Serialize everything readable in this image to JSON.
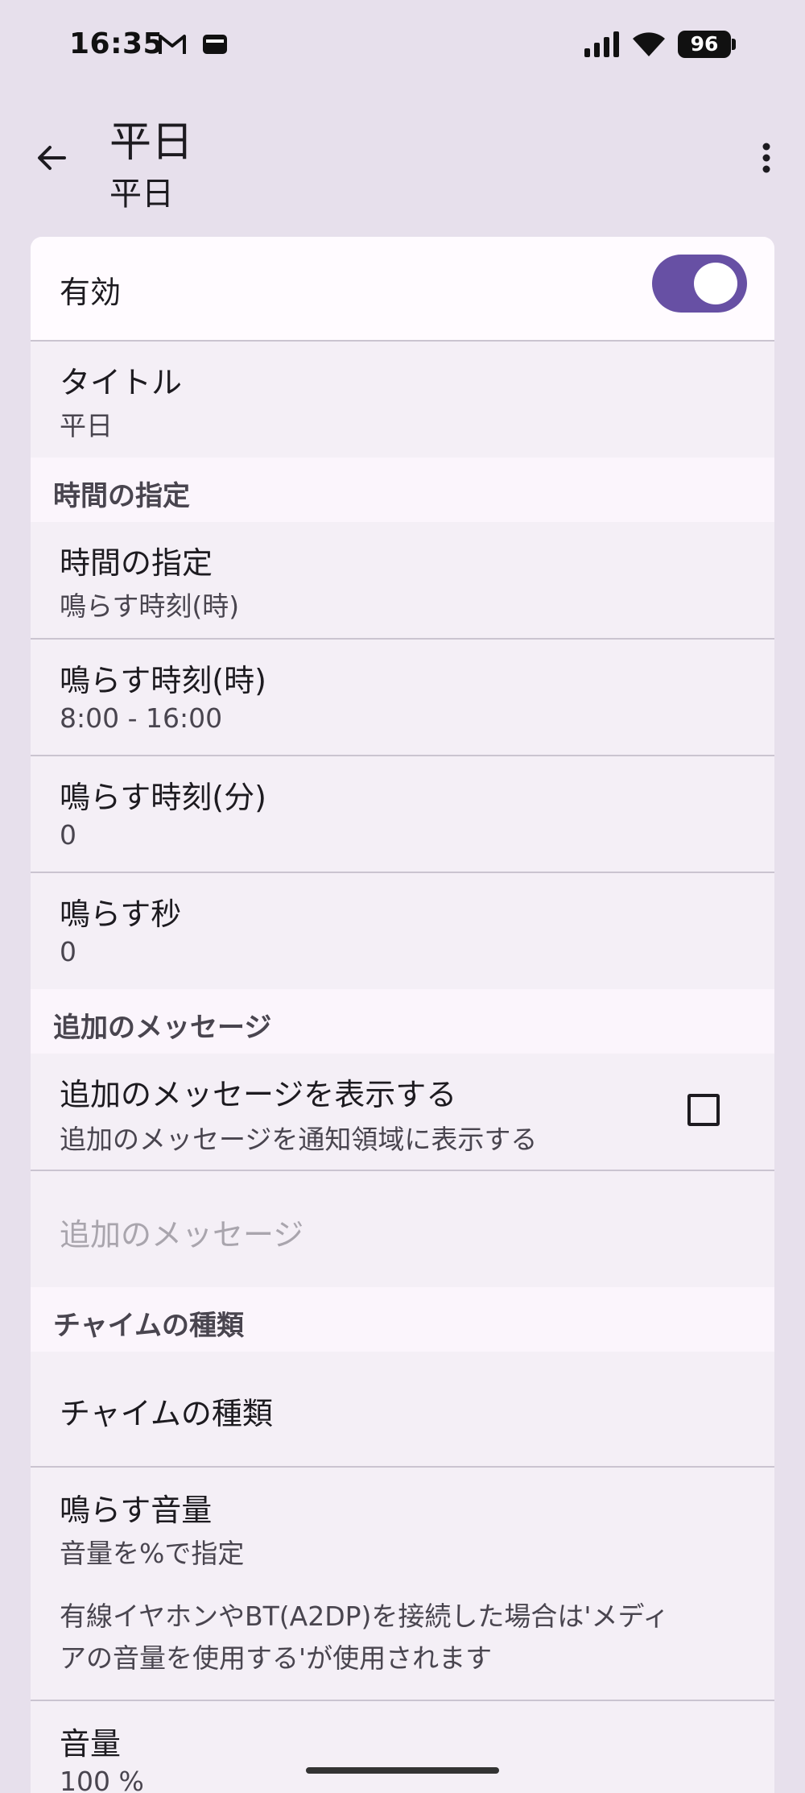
{
  "status_bar": {
    "time": "16:35",
    "battery": "96",
    "icons": [
      "gmail-icon",
      "card-icon",
      "signal-icon",
      "wifi-icon",
      "battery-icon"
    ]
  },
  "app_bar": {
    "title": "平日",
    "subtitle": "平日",
    "icons": [
      "back-arrow-icon",
      "more-vert-icon"
    ]
  },
  "colors": {
    "accent": "#6750a4",
    "background": "#e7e0ec",
    "surface": "#f4eff6",
    "section_header": "#fbf5fc",
    "divider": "#cac4d0"
  },
  "items": {
    "enabled": {
      "title": "有効",
      "checked": true
    },
    "title": {
      "title": "タイトル",
      "summary": "平日"
    },
    "section_time": "時間の指定",
    "time_spec": {
      "title": "時間の指定",
      "summary": "鳴らす時刻(時)"
    },
    "hour": {
      "title": "鳴らす時刻(時)",
      "summary": "8:00 - 16:00"
    },
    "minute": {
      "title": "鳴らす時刻(分)",
      "summary": "0"
    },
    "second": {
      "title": "鳴らす秒",
      "summary": "0"
    },
    "section_message": "追加のメッセージ",
    "show_message": {
      "title": "追加のメッセージを表示する",
      "summary": "追加のメッセージを通知領域に表示する",
      "checked": false
    },
    "message": {
      "title": "追加のメッセージ"
    },
    "section_chime": "チャイムの種類",
    "chime_type": {
      "title": "チャイムの種類"
    },
    "volume_mode": {
      "title": "鳴らす音量",
      "summary": "音量を%で指定",
      "note_line1": "有線イヤホンやBT(A2DP)を接続した場合は'メディ",
      "note_line2": "アの音量を使用する'が使用されます"
    },
    "volume": {
      "title": "音量",
      "summary": "100 %"
    }
  }
}
